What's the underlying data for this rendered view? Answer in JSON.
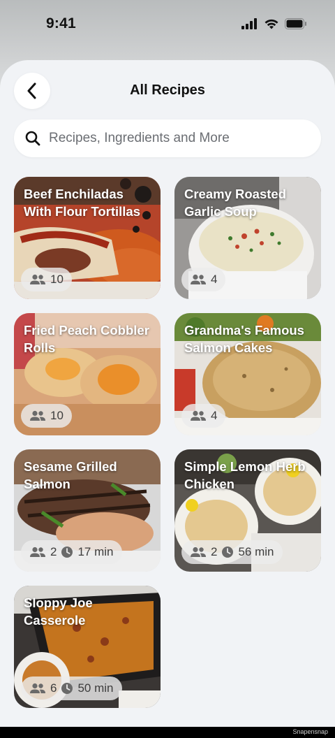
{
  "status_bar": {
    "time": "9:41"
  },
  "header": {
    "title": "All Recipes"
  },
  "search": {
    "placeholder": "Recipes, Ingredients and More"
  },
  "recipes": [
    {
      "title": "Beef Enchiladas With Flour Tortillas",
      "servings": "10",
      "time": ""
    },
    {
      "title": "Creamy Roasted Garlic Soup",
      "servings": "4",
      "time": ""
    },
    {
      "title": "Fried Peach Cobbler Rolls",
      "servings": "10",
      "time": ""
    },
    {
      "title": "Grandma's Famous Salmon Cakes",
      "servings": "4",
      "time": ""
    },
    {
      "title": "Sesame Grilled Salmon",
      "servings": "2",
      "time": "17 min"
    },
    {
      "title": "Simple Lemon Herb Chicken",
      "servings": "2",
      "time": "56 min"
    },
    {
      "title": "Sloppy Joe Casserole",
      "servings": "6",
      "time": "50 min"
    }
  ],
  "icons": {
    "back": "chevron-left-icon",
    "search": "search-icon",
    "servings": "people-icon",
    "time": "clock-icon"
  },
  "watermark": "Snapensnap"
}
